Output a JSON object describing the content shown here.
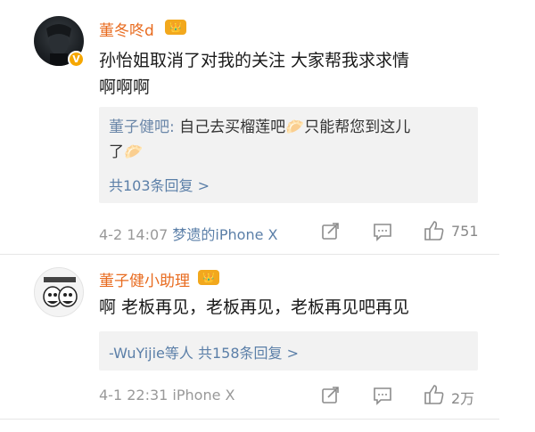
{
  "comments": [
    {
      "username": "董冬咚d",
      "vip_badge": "👑",
      "verified_badge": "V",
      "body_lines": [
        "孙怡姐取消了对我的关注 大家帮我求求情",
        "啊啊啊"
      ],
      "reply": {
        "author": "董子健吧:",
        "lines": [
          "自己去买榴莲吧🥟只能帮您到这儿",
          "了🥟"
        ],
        "more": "共103条回复 >"
      },
      "time": "4-2 14:07",
      "source": "梦遗的iPhone X",
      "like_count": "751"
    },
    {
      "username": "董子健小助理",
      "vip_badge": "👑",
      "body_lines": [
        "啊 老板再见，老板再见，老板再见吧再见"
      ],
      "reply": {
        "more": "-WuYijie等人 共158条回复 >"
      },
      "time": "4-1 22:31",
      "source": "iPhone X",
      "like_count": "2万"
    }
  ],
  "icons": {
    "share": "share-icon",
    "comment": "comment-icon",
    "like": "thumbs-up-icon"
  }
}
